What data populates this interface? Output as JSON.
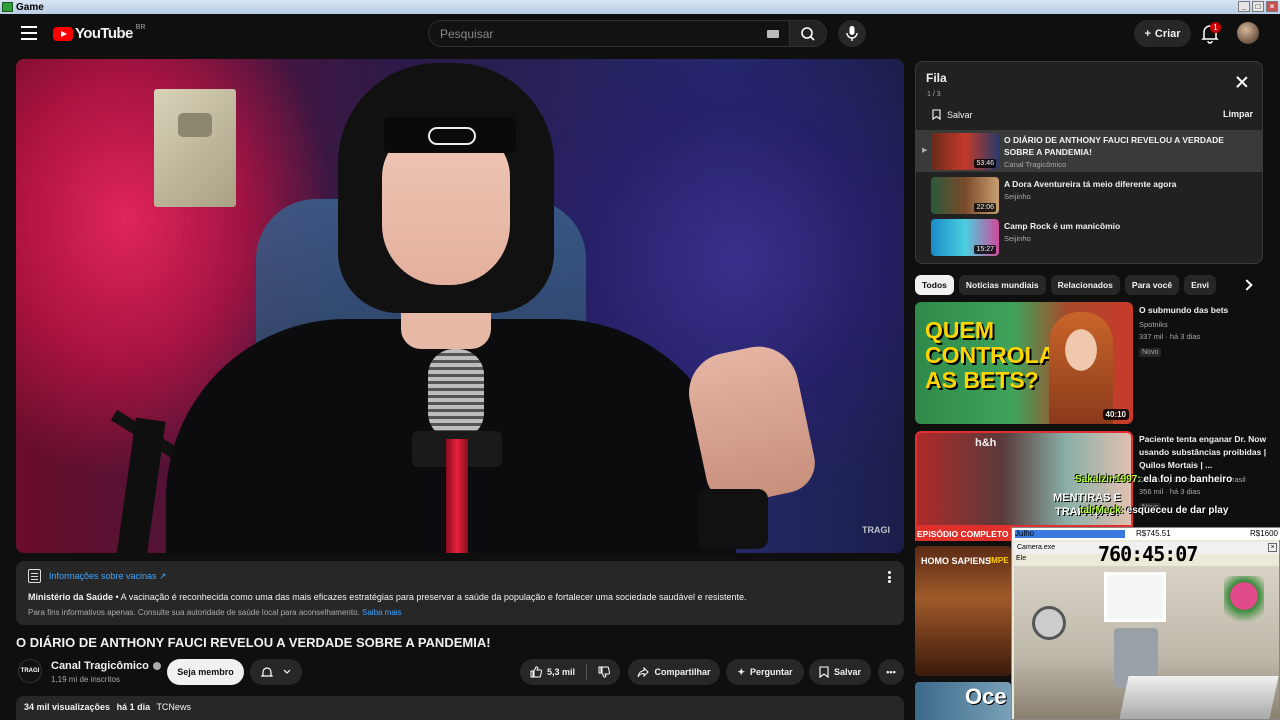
{
  "window": {
    "title": "Game"
  },
  "header": {
    "logo": "YouTube",
    "region": "BR",
    "search_placeholder": "Pesquisar",
    "create_label": "Criar",
    "notif_count": "1"
  },
  "player": {
    "watermark": "TRAGI"
  },
  "info_panel": {
    "title": "Informações sobre vacinas ↗",
    "source": "Ministério da Saúde",
    "text": " • A vacinação é reconhecida como uma das mais eficazes estratégias para preservar a saúde da população e fortalecer uma sociedade saudável e resistente.",
    "footnote": "Para fins informativos apenas. Consulte sua autoridade de saúde local para aconselhamento.",
    "more": "Saiba mais"
  },
  "video": {
    "title": "O DIÁRIO DE ANTHONY FAUCI REVELOU A VERDADE SOBRE A PANDEMIA!",
    "channel": "Canal Tragicômico",
    "channel_avatar": "TRAGI",
    "subscribers": "1,19 mi de inscritos",
    "join_label": "Seja membro",
    "likes": "5,3 mil",
    "share_label": "Compartilhar",
    "ask_label": "Perguntar",
    "save_label": "Salvar",
    "views": "34 mil visualizações",
    "age": "há 1 dia",
    "tag": "TCNews"
  },
  "queue": {
    "title": "Fila",
    "count": "1 / 3",
    "save_label": "Salvar",
    "clear_label": "Limpar",
    "items": [
      {
        "title": "O DIÁRIO DE ANTHONY FAUCI REVELOU A VERDADE SOBRE A PANDEMIA!",
        "channel": "Canal Tragicômico",
        "duration": "53:46"
      },
      {
        "title": "A Dora Aventureira tá meio diferente agora",
        "channel": "Seijinho",
        "duration": "22:06"
      },
      {
        "title": "Camp Rock é um manicômio",
        "channel": "Seijinho",
        "duration": "15:27"
      }
    ]
  },
  "chips": [
    "Todos",
    "Notícias mundiais",
    "Relacionados",
    "Para você",
    "Envi"
  ],
  "recommendations": [
    {
      "title": "O submundo das bets",
      "channel": "Spotniks",
      "meta": "337 mil · há 3 dias",
      "badge": "Novo",
      "duration": "40:10",
      "thumb_text": "QUEM CONTROLA AS BETS?"
    },
    {
      "title": "Paciente tenta enganar Dr. Now usando substâncias proibidas | Quilos Mortais | ...",
      "channel": "Discovery Home & Health Brasil",
      "meta": "356 mil · há 3 dias",
      "badge": "Novo",
      "duration": "",
      "thumb_text": "MENTIRAS E TRAPAÇAS!",
      "thumb_logo": "h&h"
    }
  ],
  "side_thumbs": {
    "banner": "EPISÓDIO COMPLETO",
    "homo_text": "HOMO SAPIENS",
    "homo_side": "IMPE",
    "oce_text": "Oce"
  },
  "chat": [
    {
      "user": "Sakalzin1997:",
      "msg": " ela foi no banheiro"
    },
    {
      "user": "talrMeck:",
      "msg": " esqueceu de dar play"
    }
  ],
  "overlay": {
    "left_label": "Julho",
    "mid_value": "R$745.51",
    "right_value": "R$1600",
    "window_title": "Camera.exe",
    "timer": "760:45:07",
    "sub_label": "Ele"
  }
}
